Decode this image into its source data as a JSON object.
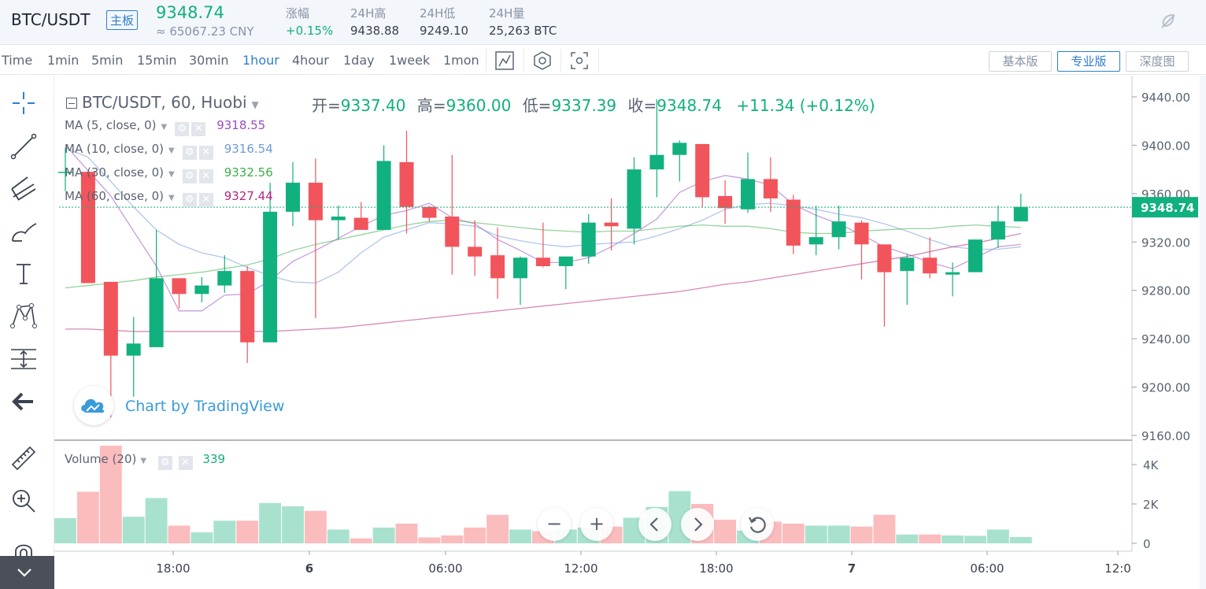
{
  "header": {
    "pair": "BTC/USDT",
    "board": "主板",
    "price": "9348.74",
    "cny": "≈ 65067.23 CNY",
    "stats": [
      {
        "label": "涨幅",
        "value": "+0.15%",
        "color": "#11b07f"
      },
      {
        "label": "24H高",
        "value": "9438.88"
      },
      {
        "label": "24H低",
        "value": "9249.10"
      },
      {
        "label": "24H量",
        "value": "25,263 BTC"
      }
    ]
  },
  "toolbar": {
    "intervals": [
      "Time",
      "1min",
      "5min",
      "15min",
      "30min",
      "1hour",
      "4hour",
      "1day",
      "1week",
      "1mon"
    ],
    "active_interval": "1hour",
    "views": [
      "基本版",
      "专业版",
      "深度图"
    ],
    "active_view": "专业版"
  },
  "colors": {
    "up": "#11b07f",
    "down": "#f2545b",
    "up_vol": "#a8e2cf",
    "down_vol": "#fbbcbe",
    "accent": "#2f7fd1"
  },
  "chart_data": {
    "type": "candlestick",
    "title": "BTC/USDT, 60, Huobi",
    "ohlc_text": {
      "o": "9337.40",
      "h": "9360.00",
      "l": "9337.39",
      "c": "9348.74",
      "chg": "+11.34 (+0.12%)"
    },
    "ohlc_labels": {
      "o": "开=",
      "h": "高=",
      "l": "低=",
      "c": "收="
    },
    "indicators": [
      {
        "name": "MA (5, close, 0)",
        "value": "9318.55",
        "color": "#9c4cc2"
      },
      {
        "name": "MA (10, close, 0)",
        "value": "9316.54",
        "color": "#6f9ad8"
      },
      {
        "name": "MA (30, close, 0)",
        "value": "9332.56",
        "color": "#3fae49"
      },
      {
        "name": "MA (60, close, 0)",
        "value": "9327.44",
        "color": "#b5267f"
      }
    ],
    "volume_label": "Volume (20)",
    "volume_value": "339",
    "watermark": "Chart by TradingView",
    "price_axis": {
      "ticks": [
        "9440.00",
        "9400.00",
        "9360.00",
        "9320.00",
        "9280.00",
        "9240.00",
        "9200.00",
        "9160.00"
      ],
      "min": 9160,
      "max": 9440,
      "last": "9348.74"
    },
    "volume_axis": {
      "ticks": [
        "4K",
        "2K",
        "0"
      ],
      "max": 4000
    },
    "time_axis": [
      "18:00",
      "6",
      "06:00",
      "12:00",
      "18:00",
      "7",
      "06:00",
      "12:0"
    ],
    "candles": [
      {
        "o": 9378,
        "h": 9398,
        "l": 9362,
        "c": 9378
      },
      {
        "o": 9378,
        "h": 9378,
        "l": 9286,
        "c": 9286
      },
      {
        "o": 9287,
        "h": 9287,
        "l": 9175,
        "c": 9226
      },
      {
        "o": 9226,
        "h": 9258,
        "l": 9192,
        "c": 9236
      },
      {
        "o": 9233,
        "h": 9330,
        "l": 9233,
        "c": 9290
      },
      {
        "o": 9290,
        "h": 9290,
        "l": 9265,
        "c": 9277
      },
      {
        "o": 9277,
        "h": 9291,
        "l": 9270,
        "c": 9284
      },
      {
        "o": 9284,
        "h": 9309,
        "l": 9278,
        "c": 9296
      },
      {
        "o": 9296,
        "h": 9300,
        "l": 9220,
        "c": 9237
      },
      {
        "o": 9237,
        "h": 9369,
        "l": 9237,
        "c": 9345
      },
      {
        "o": 9345,
        "h": 9386,
        "l": 9333,
        "c": 9369
      },
      {
        "o": 9369,
        "h": 9389,
        "l": 9257,
        "c": 9338
      },
      {
        "o": 9338,
        "h": 9350,
        "l": 9322,
        "c": 9341
      },
      {
        "o": 9340,
        "h": 9353,
        "l": 9330,
        "c": 9330
      },
      {
        "o": 9330,
        "h": 9400,
        "l": 9330,
        "c": 9387
      },
      {
        "o": 9386,
        "h": 9412,
        "l": 9327,
        "c": 9349
      },
      {
        "o": 9349,
        "h": 9350,
        "l": 9337,
        "c": 9340
      },
      {
        "o": 9341,
        "h": 9392,
        "l": 9293,
        "c": 9316
      },
      {
        "o": 9316,
        "h": 9338,
        "l": 9292,
        "c": 9308
      },
      {
        "o": 9309,
        "h": 9332,
        "l": 9273,
        "c": 9290
      },
      {
        "o": 9290,
        "h": 9308,
        "l": 9268,
        "c": 9307
      },
      {
        "o": 9307,
        "h": 9336,
        "l": 9299,
        "c": 9300
      },
      {
        "o": 9300,
        "h": 9308,
        "l": 9281,
        "c": 9308
      },
      {
        "o": 9308,
        "h": 9343,
        "l": 9302,
        "c": 9336
      },
      {
        "o": 9336,
        "h": 9356,
        "l": 9313,
        "c": 9333
      },
      {
        "o": 9331,
        "h": 9390,
        "l": 9318,
        "c": 9380
      },
      {
        "o": 9380,
        "h": 9438,
        "l": 9357,
        "c": 9392
      },
      {
        "o": 9392,
        "h": 9404,
        "l": 9370,
        "c": 9402
      },
      {
        "o": 9401,
        "h": 9401,
        "l": 9349,
        "c": 9357
      },
      {
        "o": 9358,
        "h": 9371,
        "l": 9335,
        "c": 9348
      },
      {
        "o": 9347,
        "h": 9394,
        "l": 9344,
        "c": 9372
      },
      {
        "o": 9372,
        "h": 9390,
        "l": 9345,
        "c": 9356
      },
      {
        "o": 9355,
        "h": 9359,
        "l": 9310,
        "c": 9317
      },
      {
        "o": 9318,
        "h": 9350,
        "l": 9309,
        "c": 9324
      },
      {
        "o": 9324,
        "h": 9350,
        "l": 9314,
        "c": 9337
      },
      {
        "o": 9336,
        "h": 9338,
        "l": 9289,
        "c": 9318
      },
      {
        "o": 9318,
        "h": 9318,
        "l": 9250,
        "c": 9295
      },
      {
        "o": 9296,
        "h": 9310,
        "l": 9268,
        "c": 9307
      },
      {
        "o": 9307,
        "h": 9324,
        "l": 9290,
        "c": 9294
      },
      {
        "o": 9293,
        "h": 9303,
        "l": 9275,
        "c": 9295
      },
      {
        "o": 9295,
        "h": 9322,
        "l": 9295,
        "c": 9322
      },
      {
        "o": 9322,
        "h": 9350,
        "l": 9315,
        "c": 9337
      },
      {
        "o": 9337,
        "h": 9360,
        "l": 9337,
        "c": 9349
      }
    ],
    "volume": [
      1280,
      2620,
      4960,
      1350,
      2300,
      900,
      560,
      1150,
      1150,
      2050,
      1880,
      1650,
      700,
      250,
      800,
      1000,
      300,
      400,
      800,
      1450,
      700,
      620,
      700,
      800,
      850,
      1300,
      1850,
      2650,
      2000,
      1200,
      650,
      1100,
      1000,
      900,
      900,
      850,
      1450,
      450,
      450,
      400,
      380,
      700,
      320
    ],
    "ma_series": [
      {
        "name": "MA 5",
        "color": "#9c4cc2",
        "values": [
          9400,
          9379,
          9358,
          9329,
          9300,
          9263,
          9263,
          9276,
          9277,
          9288,
          9304,
          9313,
          9323,
          9333,
          9342,
          9346,
          9352,
          9340,
          9335,
          9322,
          9313,
          9303,
          9303,
          9307,
          9316,
          9327,
          9339,
          9361,
          9370,
          9375,
          9372,
          9367,
          9351,
          9342,
          9335,
          9326,
          9316,
          9310,
          9303,
          9298,
          9307,
          9316,
          9318
        ]
      },
      {
        "name": "MA 10",
        "color": "#6f9ad8",
        "values": [
          9398,
          9390,
          9370,
          9349,
          9330,
          9318,
          9311,
          9307,
          9299,
          9292,
          9287,
          9286,
          9295,
          9311,
          9324,
          9330,
          9336,
          9335,
          9333,
          9325,
          9321,
          9318,
          9316,
          9318,
          9319,
          9320,
          9325,
          9331,
          9338,
          9347,
          9351,
          9352,
          9350,
          9347,
          9343,
          9340,
          9335,
          9329,
          9322,
          9316,
          9314,
          9314,
          9316
        ]
      },
      {
        "name": "MA 30",
        "color": "#3fae49",
        "values": [
          9282,
          9284,
          9286,
          9288,
          9291,
          9293,
          9295,
          9298,
          9301,
          9306,
          9313,
          9318,
          9322,
          9326,
          9330,
          9334,
          9337,
          9338,
          9336,
          9334,
          9332,
          9330,
          9329,
          9328,
          9329,
          9329,
          9331,
          9333,
          9334,
          9333,
          9333,
          9331,
          9328,
          9327,
          9327,
          9329,
          9330,
          9331,
          9331,
          9333,
          9334,
          9333,
          9332
        ]
      },
      {
        "name": "MA 60",
        "color": "#b5267f",
        "values": [
          9248,
          9248,
          9247,
          9246,
          9246,
          9246,
          9246,
          9246,
          9246,
          9246,
          9247,
          9248,
          9249,
          9251,
          9253,
          9255,
          9257,
          9259,
          9261,
          9263,
          9265,
          9267,
          9269,
          9271,
          9273,
          9275,
          9277,
          9279,
          9282,
          9285,
          9287,
          9290,
          9293,
          9296,
          9299,
          9302,
          9305,
          9308,
          9312,
          9316,
          9319,
          9323,
          9327
        ]
      }
    ]
  }
}
